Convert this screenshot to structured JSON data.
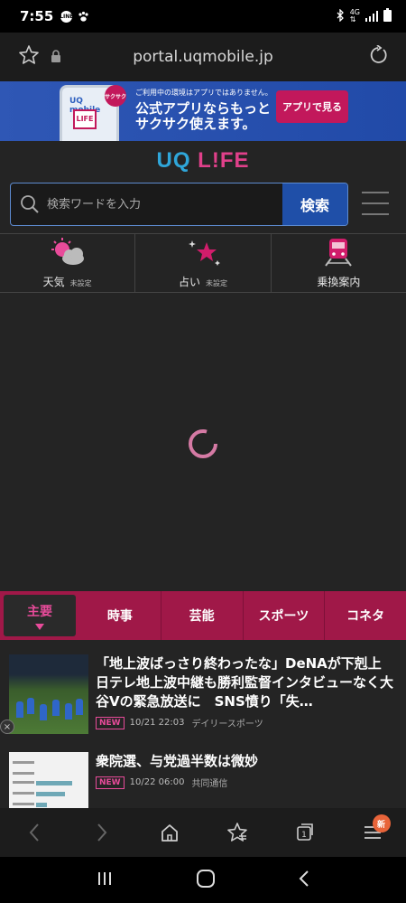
{
  "status_bar": {
    "time": "7:55",
    "network_label_top": "4G",
    "network_label_bottom": "⇅"
  },
  "address_bar": {
    "url": "portal.uqmobile.jp"
  },
  "banner": {
    "app_logo": "UQ mobile",
    "app_life": "LIFE",
    "badge": "サクサク",
    "small_text": "ご利用中の環境はアプリではありません。",
    "main_text": "公式アプリならもっとサクサク使えます。",
    "button": "アプリで見る"
  },
  "logo": {
    "uq": "UQ",
    "life": "L!FE"
  },
  "search": {
    "placeholder": "検索ワードを入力",
    "button": "検索"
  },
  "shortcuts": [
    {
      "label": "天気",
      "sub": "未設定",
      "icon": "weather-icon"
    },
    {
      "label": "占い",
      "sub": "未設定",
      "icon": "fortune-star-icon"
    },
    {
      "label": "乗換案内",
      "sub": "",
      "icon": "train-icon"
    }
  ],
  "categories": [
    "主要",
    "時事",
    "芸能",
    "スポーツ",
    "コネタ"
  ],
  "news": [
    {
      "title": "「地上波ばっさり終わったな」DeNAが下剋上　日テレ地上波中継も勝利監督インタビューなく大谷Vの緊急放送に　SNS憤り「失…",
      "badge": "NEW",
      "time": "10/21 22:03",
      "source": "デイリースポーツ"
    },
    {
      "title": "衆院選、与党過半数は微妙",
      "badge": "NEW",
      "time": "10/22 06:00",
      "source": "共同通信"
    }
  ],
  "browser_nav": {
    "tabs_count": "1",
    "menu_badge": "新"
  },
  "colors": {
    "accent_pink": "#e84b9a",
    "category_bar": "#a01848",
    "search_button": "#1f4fa8",
    "banner_blue": "#2f57b5"
  }
}
